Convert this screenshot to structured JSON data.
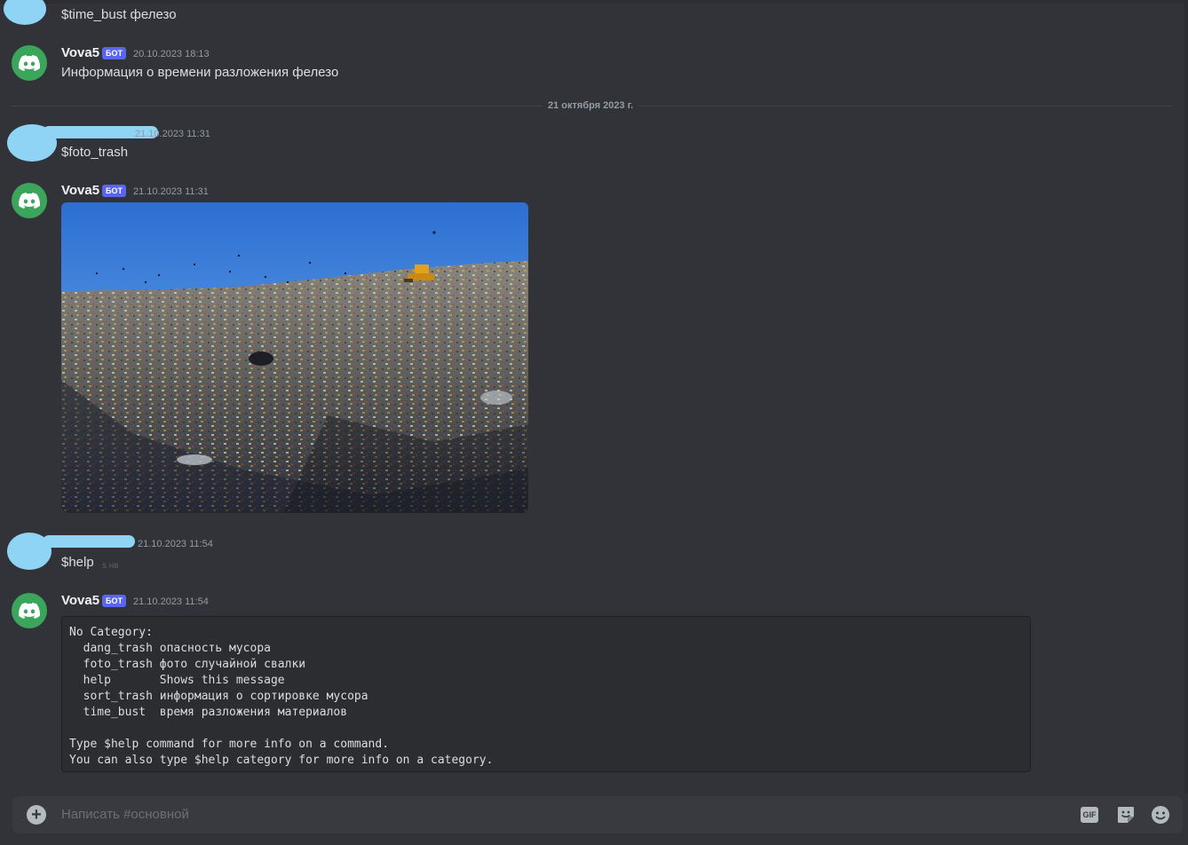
{
  "messages": {
    "top": {
      "text": "$time_bust фелезо"
    },
    "bot1": {
      "username": "Vova5",
      "badge": "БОТ",
      "timestamp": "20.10.2023 18:13",
      "text": "Информация о времени разложения фелезо"
    },
    "date_divider": "21 октября 2023 г.",
    "user2": {
      "timestamp": "21.10.2023 11:31",
      "text": "$foto_trash"
    },
    "bot2": {
      "username": "Vova5",
      "badge": "БОТ",
      "timestamp": "21.10.2023 11:31",
      "image_alt": "landfill photo"
    },
    "user3": {
      "timestamp": "21.10.2023 11:54",
      "text": "$help",
      "hint": "s  нв"
    },
    "bot3": {
      "username": "Vova5",
      "badge": "БОТ",
      "timestamp": "21.10.2023 11:54",
      "code_lines": [
        "No Category:",
        "  dang_trash опасность мусора",
        "  foto_trash фото случайной свалки",
        "  help       Shows this message",
        "  sort_trash информация о сортировке мусора",
        "  time_bust  время разложения материалов",
        "",
        "Type $help command for more info on a command.",
        "You can also type $help category for more info on a category."
      ]
    }
  },
  "composer": {
    "placeholder": "Написать #основной",
    "gif_label": "GIF"
  },
  "icons": {
    "avatar": "discord-logo-icon",
    "attach": "plus-circle-icon",
    "gif": "gif-icon",
    "sticker": "sticker-icon",
    "emoji": "emoji-icon"
  },
  "colors": {
    "background": "#313338",
    "bot_avatar": "#3ba55c",
    "bot_badge": "#5865f2",
    "redaction": "#8fd3f5"
  }
}
